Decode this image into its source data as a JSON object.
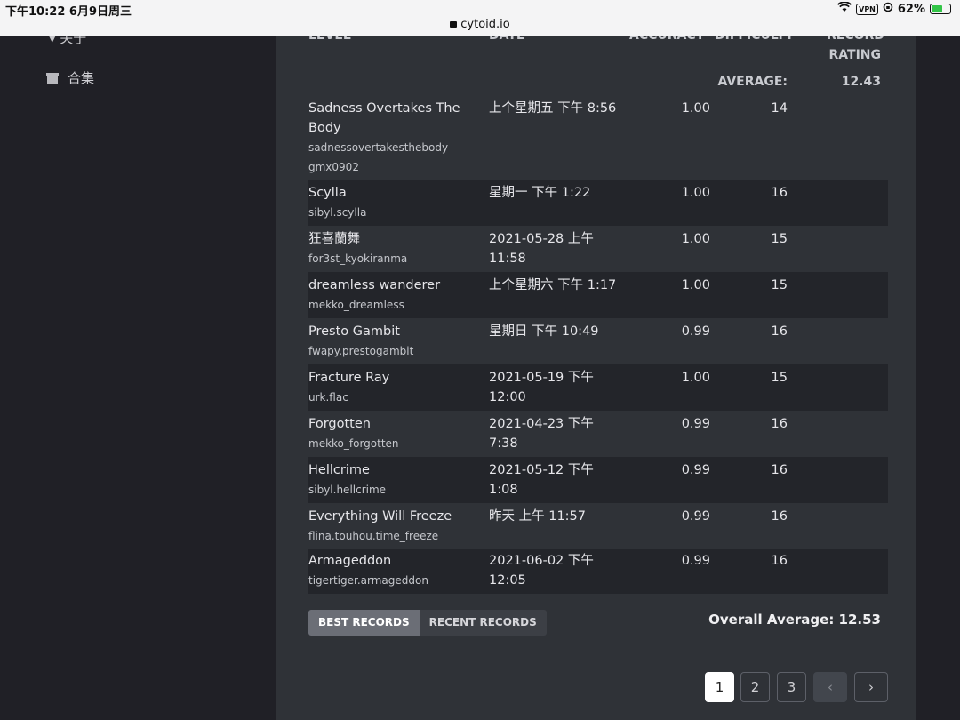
{
  "status": {
    "time_date": "下午10:22  6月9日周三",
    "vpn": "VPN",
    "battery": "62%",
    "battery_level": 0.62,
    "url": "cytoid.io"
  },
  "sidebar": {
    "partial_item": "▾ 关于",
    "item_label": "合集"
  },
  "table": {
    "headers": {
      "level": "LEVEL",
      "date": "DATE",
      "accuracy": "ACCURACY",
      "difficulty": "DIFFICULTY",
      "record": "RECORD",
      "rating": "RATING"
    },
    "average_label": "AVERAGE:",
    "average_value": "12.43",
    "rows": [
      {
        "title": "Sadness Overtakes The Body",
        "title_line2": "",
        "id": "sadnessovertakesthebody-",
        "id_line2": "gmx0902",
        "date": "上个星期五 下午 8:56",
        "date2": "",
        "accuracy": "1.00",
        "difficulty": "14"
      },
      {
        "title": "Scylla",
        "id": "sibyl.scylla",
        "date": "星期一 下午 1:22",
        "date2": "",
        "accuracy": "1.00",
        "difficulty": "16"
      },
      {
        "title": "狂喜蘭舞",
        "id": "for3st_kyokiranma",
        "date": "2021-05-28 上午",
        "date2": "11:58",
        "accuracy": "1.00",
        "difficulty": "15"
      },
      {
        "title": "dreamless wanderer",
        "id": "mekko_dreamless",
        "date": "上个星期六 下午 1:17",
        "date2": "",
        "accuracy": "1.00",
        "difficulty": "15"
      },
      {
        "title": "Presto Gambit",
        "id": "fwapy.prestogambit",
        "date": "星期日 下午 10:49",
        "date2": "",
        "accuracy": "0.99",
        "difficulty": "16"
      },
      {
        "title": "Fracture Ray",
        "id": "urk.flac",
        "date": "2021-05-19 下午",
        "date2": "12:00",
        "accuracy": "1.00",
        "difficulty": "15"
      },
      {
        "title": "Forgotten",
        "id": "mekko_forgotten",
        "date": "2021-04-23 下午",
        "date2": "7:38",
        "accuracy": "0.99",
        "difficulty": "16"
      },
      {
        "title": "Hellcrime",
        "id": "sibyl.hellcrime",
        "date": "2021-05-12 下午",
        "date2": "1:08",
        "accuracy": "0.99",
        "difficulty": "16"
      },
      {
        "title": "Everything Will Freeze",
        "id": "flina.touhou.time_freeze",
        "date": "昨天 上午 11:57",
        "date2": "",
        "accuracy": "0.99",
        "difficulty": "16"
      },
      {
        "title": "Armageddon",
        "id": "tigertiger.armageddon",
        "date": "2021-06-02 下午",
        "date2": "12:05",
        "accuracy": "0.99",
        "difficulty": "16"
      }
    ]
  },
  "toggle": {
    "best": "BEST RECORDS",
    "recent": "RECENT RECORDS"
  },
  "overall": "Overall Average: 12.53",
  "pagination": {
    "pages": [
      "1",
      "2",
      "3"
    ],
    "prev": "‹",
    "next": "›"
  }
}
